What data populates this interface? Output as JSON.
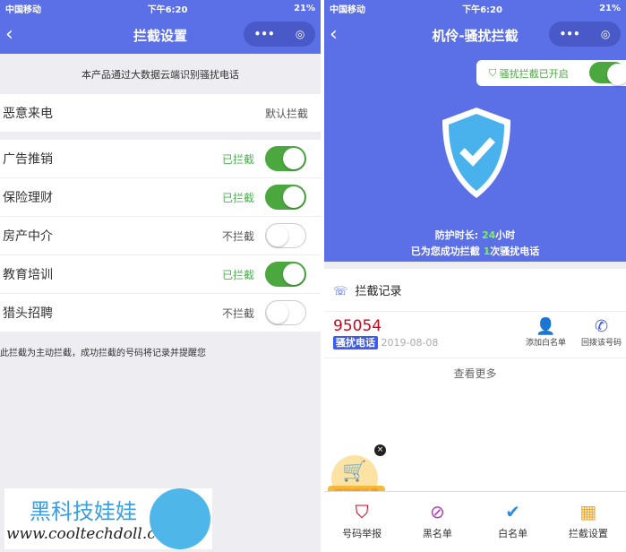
{
  "status": {
    "carrier": "中国移动",
    "time": "下午6:20",
    "battery": "21%"
  },
  "left": {
    "title": "拦截设置",
    "banner": "本产品通过大数据云端识别骚扰电话",
    "malicious": {
      "label": "恶意来电",
      "value": "默认拦截"
    },
    "items": [
      {
        "label": "广告推销",
        "status": "已拦截",
        "on": true
      },
      {
        "label": "保险理财",
        "status": "已拦截",
        "on": true
      },
      {
        "label": "房产中介",
        "status": "不拦截",
        "on": false
      },
      {
        "label": "教育培训",
        "status": "已拦截",
        "on": true
      },
      {
        "label": "猎头招聘",
        "status": "不拦截",
        "on": false
      }
    ],
    "footer": "此拦截为主动拦截，成功拦截的号码将记录并提醒您"
  },
  "right": {
    "title": "机伶-骚扰拦截",
    "toggle_label": "骚扰拦截已开启",
    "toggle_on": true,
    "duration_prefix": "防护时长: ",
    "duration_value": "24",
    "duration_suffix": "小时",
    "blocked_prefix": "已为您成功拦截 ",
    "blocked_value": "1",
    "blocked_suffix": "次骚扰电话",
    "records_title": "拦截记录",
    "record": {
      "number": "95054",
      "tag": "骚扰电话",
      "date": "2019-08-08",
      "action_whitelist": "添加白名单",
      "action_callback": "回拨该号码"
    },
    "more": "查看更多",
    "promo": "挖矿赚话费",
    "nav": [
      {
        "label": "号码举报",
        "icon": "shield-alert-icon"
      },
      {
        "label": "黑名单",
        "icon": "user-block-icon"
      },
      {
        "label": "白名单",
        "icon": "user-check-icon"
      },
      {
        "label": "拦截设置",
        "icon": "grid-icon"
      }
    ]
  },
  "watermark": {
    "name": "黑科技娃娃",
    "url": "www.cooltechdoll.com"
  },
  "colors": {
    "header": "#5b6fe6",
    "switch_on": "#4aa83f",
    "number": "#d0021b",
    "tag": "#3d5af1"
  }
}
